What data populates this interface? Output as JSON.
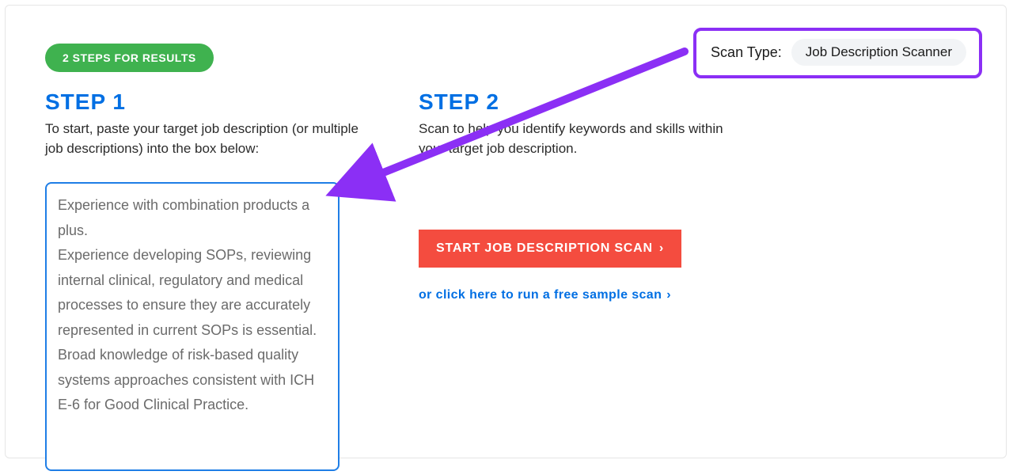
{
  "scan_type": {
    "label": "Scan Type:",
    "value": "Job Description Scanner"
  },
  "badge": "2 STEPS FOR RESULTS",
  "step1": {
    "title": "STEP 1",
    "desc": "To start, paste your target job description (or multiple job descriptions) into the box below:",
    "textarea_value": "Experience with combination products a plus.\nExperience developing SOPs, reviewing internal clinical, regulatory and medical processes to ensure they are accurately represented in current SOPs is essential.\nBroad knowledge of risk-based quality systems approaches consistent with ICH E-6 for Good Clinical Practice."
  },
  "step2": {
    "title": "STEP 2",
    "desc": "Scan to help you identify keywords and skills within your target job description.",
    "scan_button": "START JOB DESCRIPTION SCAN",
    "sample_link": "or click here to run a free sample scan"
  },
  "colors": {
    "accent_blue": "#006fe3",
    "badge_green": "#3fb24f",
    "cta_red": "#f44c3f",
    "annotation_purple": "#8b2ff5"
  }
}
